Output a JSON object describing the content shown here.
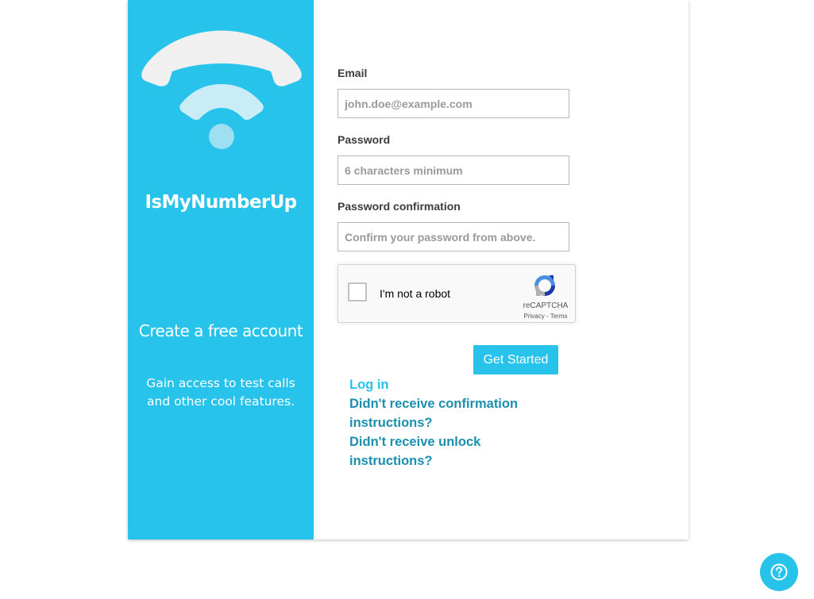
{
  "brand": {
    "name": "IsMyNumberUp"
  },
  "side": {
    "create_title": "Create a free account",
    "gain_text": "Gain access to test calls and other cool features."
  },
  "form": {
    "email": {
      "label": "Email",
      "placeholder": "john.doe@example.com",
      "value": ""
    },
    "password": {
      "label": "Password",
      "placeholder": "6 characters minimum",
      "value": ""
    },
    "password_confirmation": {
      "label": "Password confirmation",
      "placeholder": "Confirm your password from above.",
      "value": ""
    },
    "recaptcha": {
      "label": "I'm not a robot",
      "brand": "reCAPTCHA",
      "terms": "Privacy - Terms",
      "checked": false
    },
    "submit_label": "Get Started"
  },
  "links": {
    "login": "Log in",
    "confirmation": "Didn't receive confirmation instructions?",
    "unlock": "Didn't receive unlock instructions?"
  },
  "icons": {
    "logo": "phone-wifi-logo",
    "recaptcha": "recaptcha-icon",
    "help": "question-mark-icon"
  },
  "colors": {
    "accent": "#27c3ea",
    "link": "#1a8fb0"
  }
}
